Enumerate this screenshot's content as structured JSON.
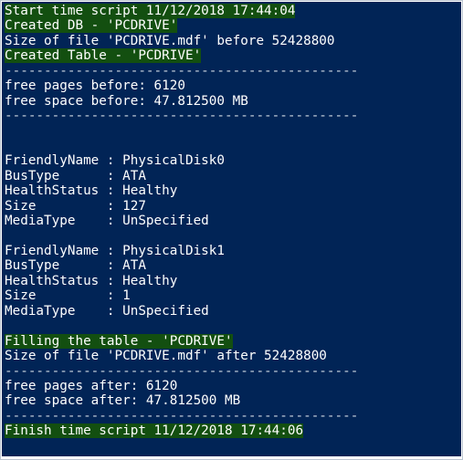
{
  "console": {
    "lines": [
      {
        "text": "Start time script 11/12/2018 17:44:04",
        "style": "highlight"
      },
      {
        "text": "Created DB - 'PCDRIVE'",
        "style": "highlight"
      },
      {
        "text": "Size of file 'PCDRIVE.mdf' before 52428800",
        "style": "normal"
      },
      {
        "text": "Created Table - 'PCDRIVE'",
        "style": "highlight"
      },
      {
        "text": "---------------------------------------------",
        "style": "separator"
      },
      {
        "text": "free pages before: 6120",
        "style": "normal"
      },
      {
        "text": "free space before: 47.812500 MB",
        "style": "normal"
      },
      {
        "text": "---------------------------------------------",
        "style": "separator"
      },
      {
        "text": "",
        "style": "normal"
      },
      {
        "text": "",
        "style": "normal"
      },
      {
        "text": "FriendlyName : PhysicalDisk0",
        "style": "normal"
      },
      {
        "text": "BusType      : ATA",
        "style": "normal"
      },
      {
        "text": "HealthStatus : Healthy",
        "style": "normal"
      },
      {
        "text": "Size         : 127",
        "style": "normal"
      },
      {
        "text": "MediaType    : UnSpecified",
        "style": "normal"
      },
      {
        "text": "",
        "style": "normal"
      },
      {
        "text": "FriendlyName : PhysicalDisk1",
        "style": "normal"
      },
      {
        "text": "BusType      : ATA",
        "style": "normal"
      },
      {
        "text": "HealthStatus : Healthy",
        "style": "normal"
      },
      {
        "text": "Size         : 1",
        "style": "normal"
      },
      {
        "text": "MediaType    : UnSpecified",
        "style": "normal"
      },
      {
        "text": "",
        "style": "normal"
      },
      {
        "text": "Filling the table - 'PCDRIVE'",
        "style": "highlight"
      },
      {
        "text": "Size of file 'PCDRIVE.mdf' after 52428800",
        "style": "normal"
      },
      {
        "text": "---------------------------------------------",
        "style": "separator"
      },
      {
        "text": "free pages after: 6120",
        "style": "normal"
      },
      {
        "text": "free space after: 47.812500 MB",
        "style": "normal"
      },
      {
        "text": "---------------------------------------------",
        "style": "separator"
      },
      {
        "text": "Finish time script 11/12/2018 17:44:06",
        "style": "highlight"
      }
    ]
  },
  "colors": {
    "background": "#012456",
    "text": "#ffffff",
    "highlight": "#134f10"
  }
}
